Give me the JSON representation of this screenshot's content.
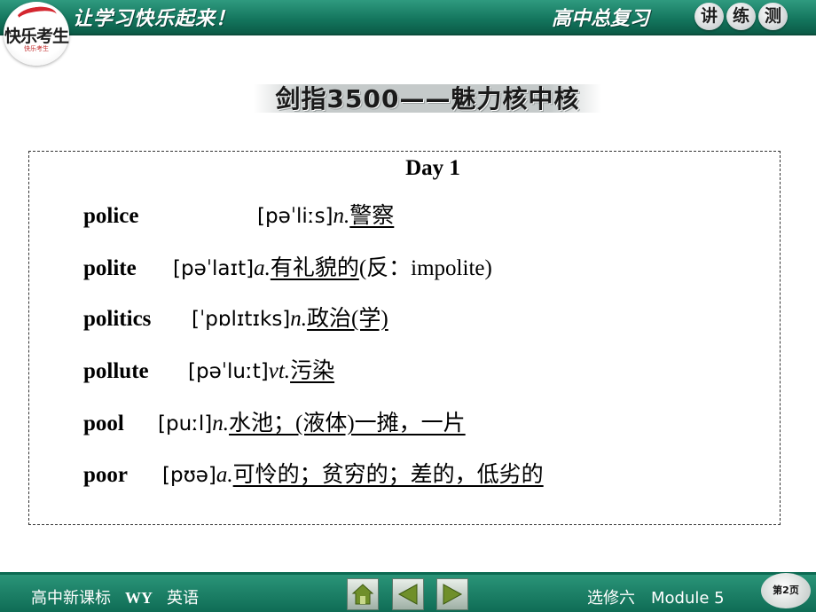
{
  "header": {
    "logo_title": "快乐考生",
    "logo_sub": "快乐考生",
    "slogan": "让学习快乐起来！",
    "series": "高中总复习",
    "badges": [
      "讲",
      "练",
      "测"
    ]
  },
  "section_title": "剑指3500——魅力核中核",
  "day": "Day 1",
  "entries": [
    {
      "word": "police",
      "phonetic": "[pəˈliːs]",
      "pos": "n.",
      "definition": "警察",
      "note": ""
    },
    {
      "word": "polite",
      "phonetic": "[pəˈlaɪt]",
      "pos": "a.",
      "definition": "有礼貌的",
      "note": "(反：impolite)"
    },
    {
      "word": "politics",
      "phonetic": "[ˈpɒlɪtɪks]",
      "pos": "n.",
      "definition": "政治(学)",
      "note": ""
    },
    {
      "word": "pollute",
      "phonetic": "[pəˈluːt]",
      "pos": "vt.",
      "definition": "污染",
      "note": ""
    },
    {
      "word": "pool",
      "phonetic": "[puːl]",
      "pos": "n.",
      "definition": "水池；(液体)一摊，一片",
      "note": ""
    },
    {
      "word": "poor",
      "phonetic": "[pʊə]",
      "pos": "a.",
      "definition": "可怜的；贫穷的；差的，低劣的",
      "note": ""
    }
  ],
  "footer": {
    "course": "高中新课标",
    "edition": "WY",
    "subject": "英语",
    "module": "选修六　Module 5",
    "page": "第2页"
  },
  "colors": {
    "bar_green": "#13745c",
    "text": "#000000"
  }
}
